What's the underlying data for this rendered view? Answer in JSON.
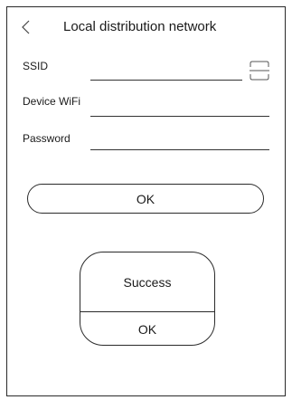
{
  "header": {
    "title": "Local distribution network",
    "back_icon": "chevron-left-icon"
  },
  "form": {
    "ssid": {
      "label": "SSID",
      "value": "",
      "scan_icon": "scan-icon"
    },
    "device_wifi": {
      "label": "Device WiFi",
      "value": ""
    },
    "password": {
      "label": "Password",
      "value": ""
    }
  },
  "actions": {
    "ok_label": "OK"
  },
  "dialog": {
    "message": "Success",
    "ok_label": "OK"
  }
}
